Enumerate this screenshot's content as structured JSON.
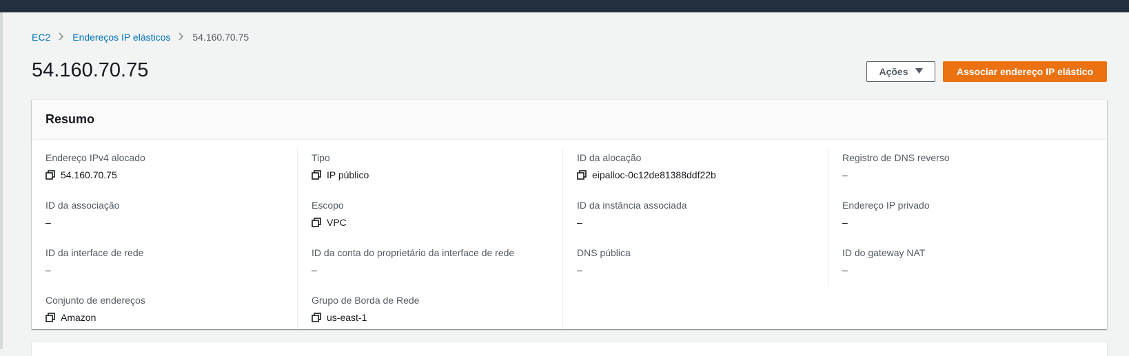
{
  "breadcrumb": {
    "items": [
      {
        "label": "EC2"
      },
      {
        "label": "Endereços IP elásticos"
      }
    ],
    "current": "54.160.70.75"
  },
  "page": {
    "title": "54.160.70.75"
  },
  "header_actions": {
    "actions_label": "Ações",
    "associate_label": "Associar endereço IP elástico"
  },
  "summary": {
    "title": "Resumo",
    "columns": [
      [
        {
          "label": "Endereço IPv4 alocado",
          "value": "54.160.70.75",
          "copy": true
        },
        {
          "label": "ID da associação",
          "value": "–",
          "copy": false
        },
        {
          "label": "ID da interface de rede",
          "value": "–",
          "copy": false
        },
        {
          "label": "Conjunto de endereços",
          "value": "Amazon",
          "copy": true
        }
      ],
      [
        {
          "label": "Tipo",
          "value": "IP público",
          "copy": true
        },
        {
          "label": "Escopo",
          "value": "VPC",
          "copy": true
        },
        {
          "label": "ID da conta do proprietário da interface de rede",
          "value": "–",
          "copy": false
        },
        {
          "label": "Grupo de Borda de Rede",
          "value": "us-east-1",
          "copy": true
        }
      ],
      [
        {
          "label": "ID da alocação",
          "value": "eipalloc-0c12de81388ddf22b",
          "copy": true
        },
        {
          "label": "ID da instância associada",
          "value": "–",
          "copy": false
        },
        {
          "label": "DNS pública",
          "value": "–",
          "copy": false
        }
      ],
      [
        {
          "label": "Registro de DNS reverso",
          "value": "–",
          "copy": false
        },
        {
          "label": "Endereço IP privado",
          "value": "–",
          "copy": false
        },
        {
          "label": "ID do gateway NAT",
          "value": "–",
          "copy": false
        }
      ]
    ]
  },
  "colors": {
    "link": "#0073bb",
    "primary_button": "#ec7211",
    "topbar": "#232f3e"
  }
}
